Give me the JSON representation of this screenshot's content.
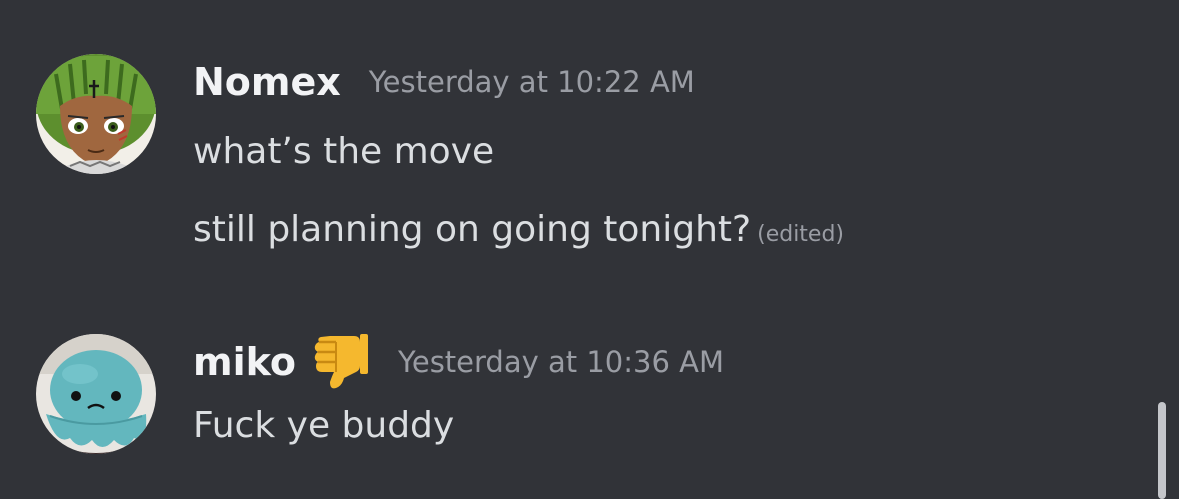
{
  "messages": [
    {
      "username": "Nomex",
      "timestamp": "Yesterday at 10:22 AM",
      "lines": [
        {
          "text": "what’s the move",
          "edited": ""
        },
        {
          "text": "still planning on going tonight?",
          "edited": "(edited)"
        }
      ],
      "avatar_icon": "anime-avatar-icon"
    },
    {
      "username": "miko",
      "timestamp": "Yesterday at 10:36 AM",
      "role_icon": "thumbs-down-icon",
      "lines": [
        {
          "text": "Fuck ye buddy"
        }
      ],
      "avatar_icon": "octopus-plush-avatar-icon"
    }
  ],
  "colors": {
    "background": "#313338",
    "username": "#f2f3f5",
    "message_text": "#dbdee1",
    "muted_text": "#9a9da4",
    "scrollbar": "#c4c6ca"
  }
}
